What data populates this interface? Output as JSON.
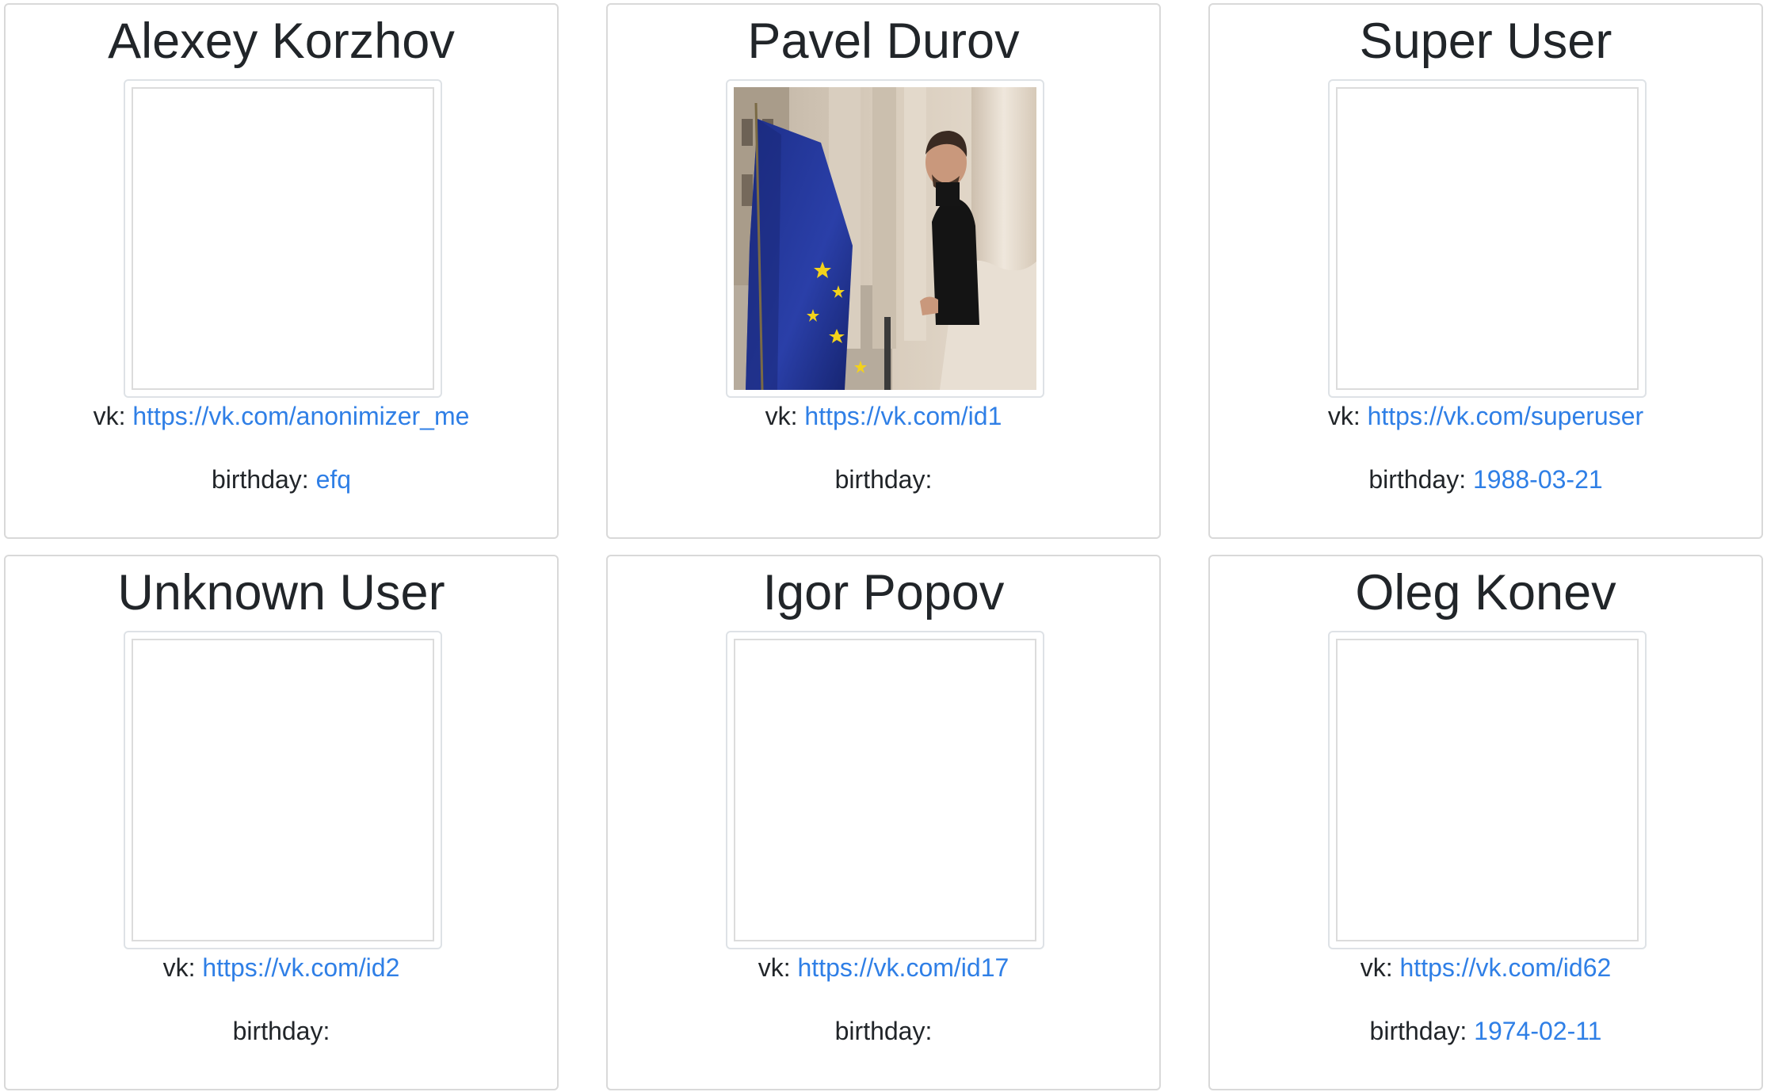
{
  "users": [
    {
      "name": "Alexey Korzhov",
      "vk_label": "vk:",
      "vk_url": "https://vk.com/anonimizer_me",
      "birthday_label": "birthday:",
      "birthday": "efq",
      "has_photo": false
    },
    {
      "name": "Pavel Durov",
      "vk_label": "vk:",
      "vk_url": "https://vk.com/id1",
      "birthday_label": "birthday:",
      "birthday": "",
      "has_photo": true
    },
    {
      "name": "Super User",
      "vk_label": "vk:",
      "vk_url": "https://vk.com/superuser",
      "birthday_label": "birthday:",
      "birthday": "1988-03-21",
      "has_photo": false
    },
    {
      "name": "Unknown User",
      "vk_label": "vk:",
      "vk_url": "https://vk.com/id2",
      "birthday_label": "birthday:",
      "birthday": "",
      "has_photo": false
    },
    {
      "name": "Igor Popov",
      "vk_label": "vk:",
      "vk_url": "https://vk.com/id17",
      "birthday_label": "birthday:",
      "birthday": "",
      "has_photo": false
    },
    {
      "name": "Oleg Konev",
      "vk_label": "vk:",
      "vk_url": "https://vk.com/id62",
      "birthday_label": "birthday:",
      "birthday": "1974-02-11",
      "has_photo": false
    }
  ],
  "colors": {
    "link": "#2f7fe6",
    "text": "#212529",
    "card_border": "#d9d9d9"
  }
}
